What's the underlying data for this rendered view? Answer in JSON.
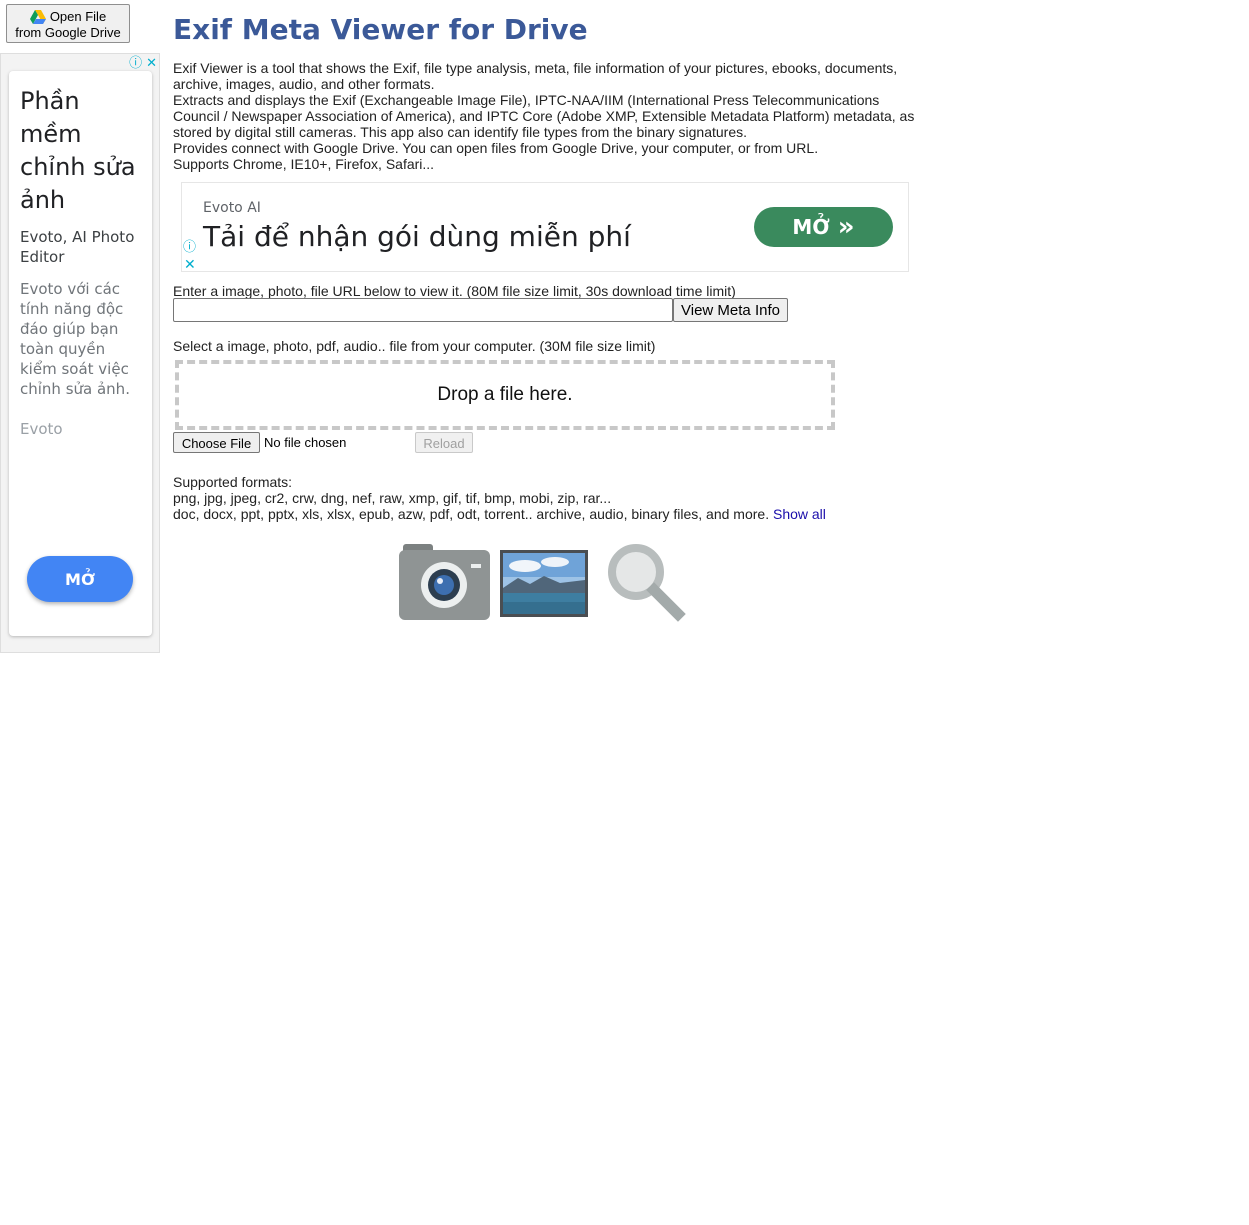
{
  "drive_button": {
    "line1": "Open File",
    "line2": "from Google Drive"
  },
  "side_ad": {
    "title": "Phần mềm chỉnh sửa ảnh",
    "brand": "Evoto, AI Photo Editor",
    "description": "Evoto với các tính năng độc đáo giúp bạn toàn quyền kiểm soát việc chỉnh sửa ảnh.",
    "advertiser": "Evoto",
    "cta": "MỞ"
  },
  "page_title": "Exif Meta Viewer for Drive",
  "intro_lines": [
    "Exif Viewer is a tool that shows the Exif, file type analysis, meta, file information of your pictures, ebooks, documents,",
    "archive, images, audio, and other formats.",
    "Extracts and displays the Exif (Exchangeable Image File), IPTC-NAA/IIM (International Press Telecommunications",
    "Council / Newspaper Association of America), and IPTC Core (Adobe XMP, Extensible Metadata Platform) metadata, as",
    "stored by digital still cameras. This app also can identify file types from the binary signatures.",
    "Provides connect with Google Drive. You can open files from Google Drive, your computer, or from URL.",
    "Supports Chrome, IE10+, Firefox, Safari..."
  ],
  "banner_ad": {
    "advertiser": "Evoto AI",
    "headline": "Tải để nhận gói dùng miễn phí",
    "cta": "MỞ",
    "cta_arrow": "»"
  },
  "url_section": {
    "label": "Enter a image, photo, file URL below to view it. (80M file size limit, 30s download time limit)",
    "input_value": "",
    "button": "View Meta Info"
  },
  "file_section": {
    "label": "Select a image, photo, pdf, audio.. file from your computer. (30M file size limit)",
    "drop_text": "Drop a file here.",
    "choose_button": "Choose File",
    "no_file": "No file chosen",
    "reload_button": "Reload"
  },
  "formats": {
    "heading": "Supported formats:",
    "line1": "png, jpg, jpeg, cr2, crw, dng, nef, raw, xmp, gif, tif, bmp, mobi, zip, rar...",
    "line2": "doc, docx, ppt, pptx, xls, xlsx, epub, azw, pdf, odt, torrent.. archive, audio, binary files, and more. ",
    "show_all": "Show all"
  },
  "icons": [
    "camera-icon",
    "landscape-photo-icon",
    "magnifier-icon"
  ],
  "colors": {
    "title": "#3b5998",
    "side_cta": "#4285f4",
    "banner_cta": "#3a8a5d",
    "link": "#1a0dab"
  }
}
